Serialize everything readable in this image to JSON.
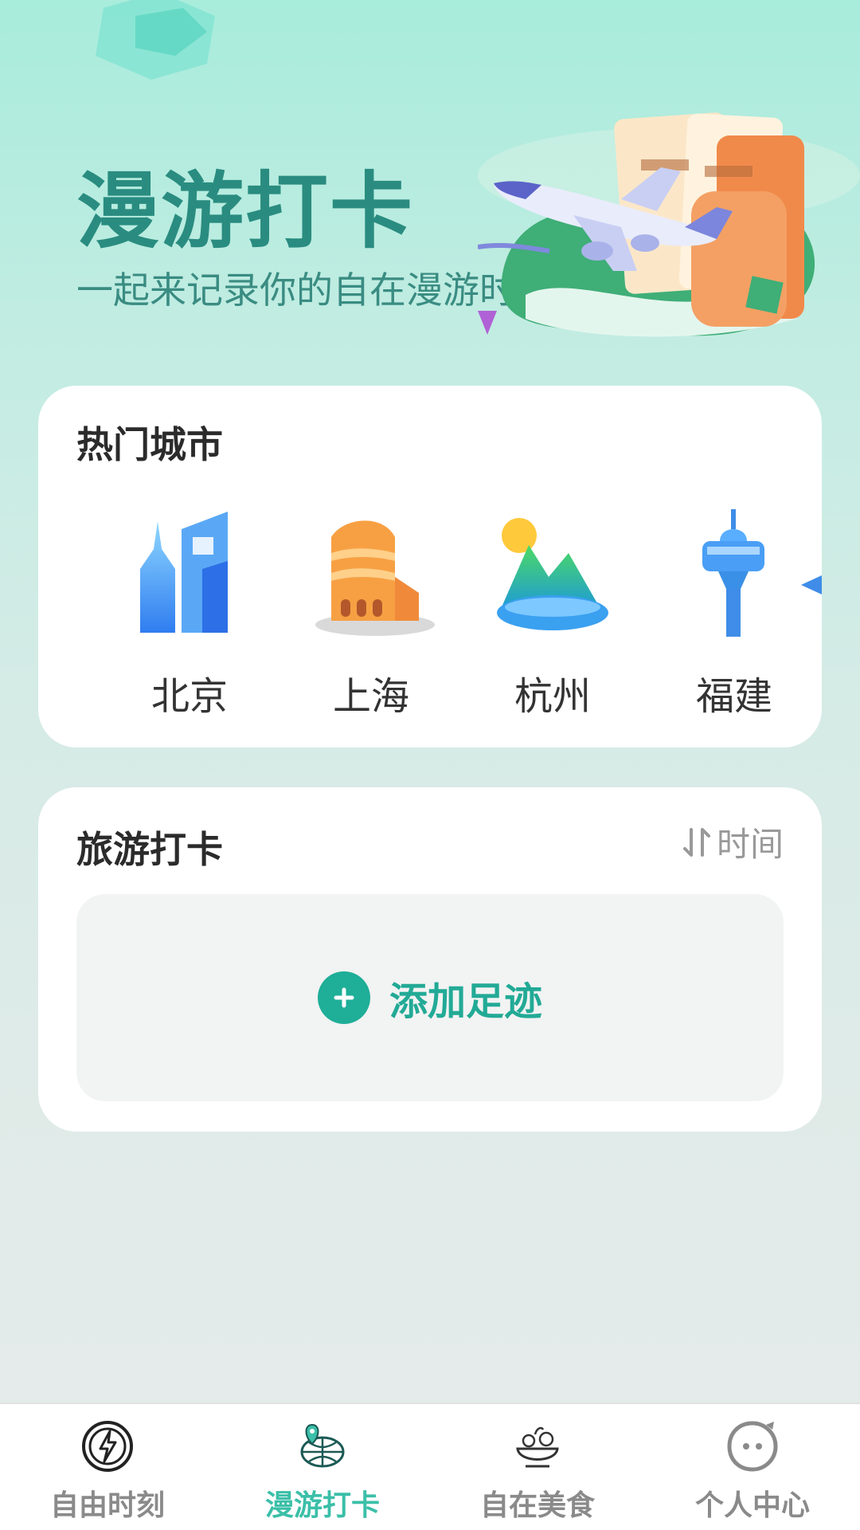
{
  "hero": {
    "title": "漫游打卡",
    "subtitle": "一起来记录你的自在漫游时刻吧"
  },
  "hot_cities": {
    "title": "热门城市",
    "cities": [
      {
        "name": "北京",
        "icon": "beijing-building-icon"
      },
      {
        "name": "上海",
        "icon": "shanghai-building-icon"
      },
      {
        "name": "杭州",
        "icon": "hangzhou-mountain-icon"
      },
      {
        "name": "福建",
        "icon": "fujian-tower-icon"
      }
    ]
  },
  "travel": {
    "title": "旅游打卡",
    "sort_label": "时间",
    "sort_icon": "sort-arrows-icon",
    "add_label": "添加足迹",
    "add_icon": "plus-icon"
  },
  "tabbar": {
    "tabs": [
      {
        "label": "自由时刻",
        "icon": "lightning-icon",
        "active": false
      },
      {
        "label": "漫游打卡",
        "icon": "globe-pin-icon",
        "active": true
      },
      {
        "label": "自在美食",
        "icon": "food-bowl-icon",
        "active": false
      },
      {
        "label": "个人中心",
        "icon": "smiley-face-icon",
        "active": false
      }
    ]
  },
  "colors": {
    "accent": "#1fae98",
    "hero_title": "#2a8c80",
    "tab_active": "#3bbfa8",
    "tab_inactive": "#8a8a8a"
  }
}
